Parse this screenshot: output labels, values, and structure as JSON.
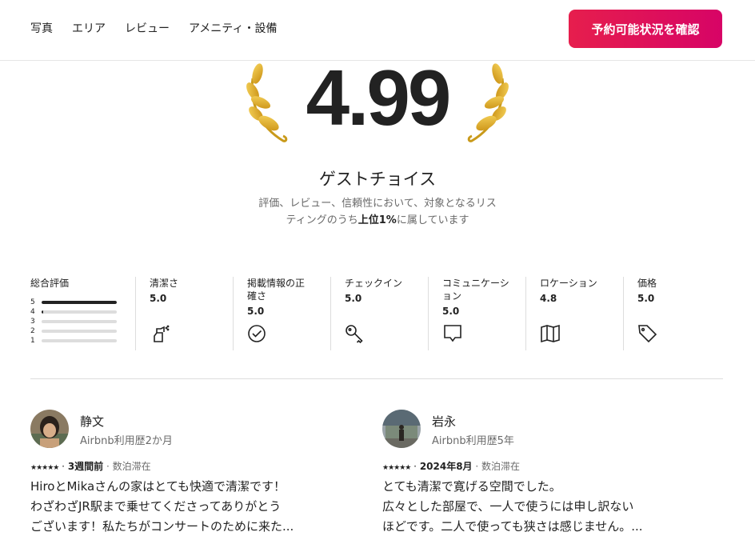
{
  "nav": {
    "links": [
      "写真",
      "エリア",
      "レビュー",
      "アメニティ・設備"
    ],
    "reserve_button": "予約可能状況を確認"
  },
  "hero": {
    "rating": "4.99",
    "title": "ゲストチョイス",
    "desc_pre": "評価、レビュー、信頼性において、対象となるリスティングのうち",
    "desc_bold": "上位1%",
    "desc_post": "に属しています"
  },
  "overall": {
    "label": "総合評価",
    "bars": [
      {
        "star": "5",
        "fill": 1.0
      },
      {
        "star": "4",
        "fill": 0.02
      },
      {
        "star": "3",
        "fill": 0
      },
      {
        "star": "2",
        "fill": 0
      },
      {
        "star": "1",
        "fill": 0
      }
    ]
  },
  "categories": [
    {
      "label": "清潔さ",
      "value": "5.0",
      "icon": "spray-bottle-icon"
    },
    {
      "label": "掲載情報の正確さ",
      "value": "5.0",
      "icon": "check-circle-icon"
    },
    {
      "label": "チェックイン",
      "value": "5.0",
      "icon": "key-icon"
    },
    {
      "label": "コミュニケーション",
      "value": "5.0",
      "icon": "chat-bubble-icon"
    },
    {
      "label": "ロケーション",
      "value": "4.8",
      "icon": "map-icon"
    },
    {
      "label": "価格",
      "value": "5.0",
      "icon": "price-tag-icon"
    }
  ],
  "reviews": [
    {
      "name": "静文",
      "since": "Airbnb利用歴2か月",
      "stars": "★★★★★",
      "when": "3週間前",
      "stay": "数泊滞在",
      "lines": [
        "HiroとMikaさんの家はとても快適で清潔です！",
        "わざわざJR駅まで乗せてくださってありがとう",
        "ございます！私たちがコンサートのために来た..."
      ]
    },
    {
      "name": "岩永",
      "since": "Airbnb利用歴5年",
      "stars": "★★★★★",
      "when": "2024年8月",
      "stay": "数泊滞在",
      "lines": [
        "とても清潔で寛げる空間でした。",
        "広々とした部屋で、一人で使うには申し訳ない",
        "ほどです。二人で使っても狭さは感じません。..."
      ]
    }
  ],
  "colors": {
    "accent_start": "#e61e4d",
    "accent_end": "#d70466",
    "laurel": "#e2b52c"
  }
}
